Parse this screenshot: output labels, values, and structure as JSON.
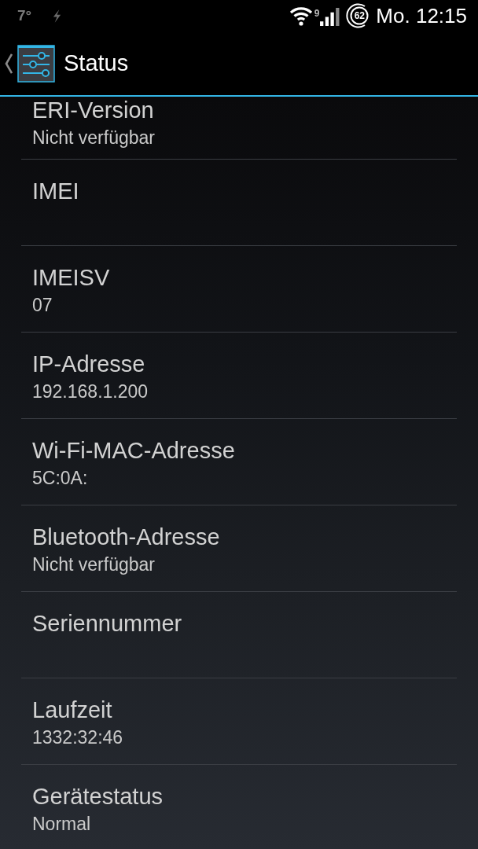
{
  "status_bar": {
    "temperature": "7°",
    "wifi_badge": "9",
    "battery": "62",
    "clock": "Mo. 12:15"
  },
  "action_bar": {
    "title": "Status"
  },
  "preferences": [
    {
      "title": "ERI-Version",
      "summary": "Nicht verfügbar"
    },
    {
      "title": "IMEI"
    },
    {
      "title": "IMEISV",
      "summary": "07"
    },
    {
      "title": "IP-Adresse",
      "summary": "192.168.1.200"
    },
    {
      "title": "Wi-Fi-MAC-Adresse",
      "summary": "5C:0A:"
    },
    {
      "title": "Bluetooth-Adresse",
      "summary": "Nicht verfügbar"
    },
    {
      "title": "Seriennummer"
    },
    {
      "title": "Laufzeit",
      "summary": "1332:32:46"
    },
    {
      "title": "Gerätestatus",
      "summary": "Normal"
    }
  ]
}
